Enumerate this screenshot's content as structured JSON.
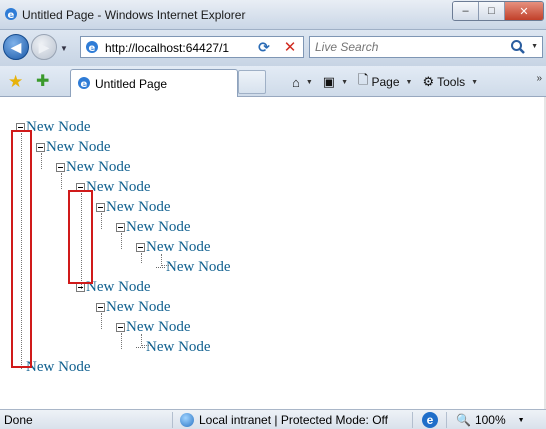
{
  "window": {
    "title": "Untitled Page - Windows Internet Explorer",
    "buttons": {
      "minimize": "–",
      "maximize": "□",
      "close": "✕"
    }
  },
  "address": {
    "url": "http://localhost:64427/1",
    "search_placeholder": "Live Search"
  },
  "tabs": [
    {
      "label": "Untitled Page"
    }
  ],
  "commands": {
    "page_label": "Page",
    "tools_label": "Tools"
  },
  "tree": {
    "nodes": [
      {
        "label": "New Node",
        "depth": 0
      },
      {
        "label": "New Node",
        "depth": 1
      },
      {
        "label": "New Node",
        "depth": 2
      },
      {
        "label": "New Node",
        "depth": 3
      },
      {
        "label": "New Node",
        "depth": 4
      },
      {
        "label": "New Node",
        "depth": 5
      },
      {
        "label": "New Node",
        "depth": 6
      },
      {
        "label": "New Node",
        "depth": 7
      },
      {
        "label": "New Node",
        "depth": 3
      },
      {
        "label": "New Node",
        "depth": 4
      },
      {
        "label": "New Node",
        "depth": 5
      },
      {
        "label": "New Node",
        "depth": 6
      },
      {
        "label": "New Node",
        "depth": 0
      }
    ]
  },
  "status": {
    "text": "Done",
    "zone": "Local intranet | Protected Mode: Off",
    "zoom": "100%"
  },
  "colors": {
    "link": "#10608f",
    "annotation_box": "#d01a1a"
  }
}
